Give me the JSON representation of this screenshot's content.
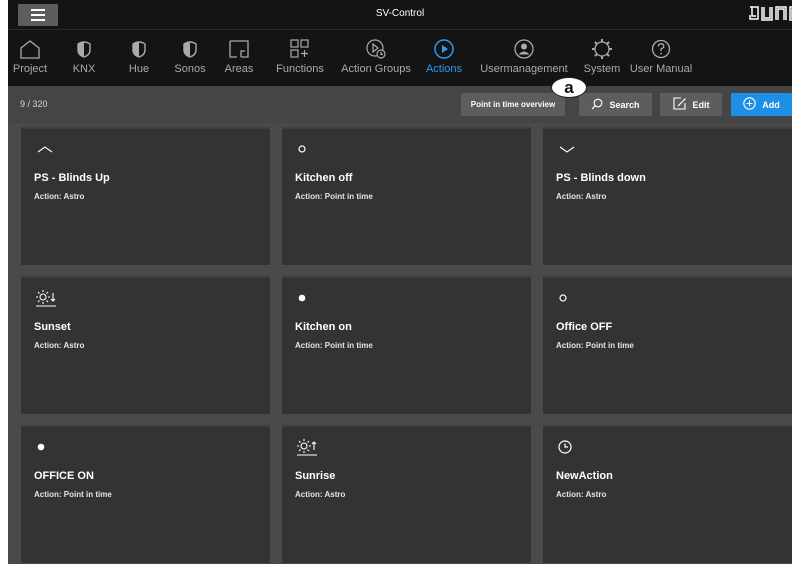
{
  "window": {
    "title": "SV-Control",
    "logo_text": "JUNG"
  },
  "nav": [
    {
      "label": "Project",
      "icon": "home-icon",
      "active": false
    },
    {
      "label": "KNX",
      "icon": "half-shield-icon",
      "active": false
    },
    {
      "label": "Hue",
      "icon": "half-shield-icon",
      "active": false
    },
    {
      "label": "Sonos",
      "icon": "half-shield-icon",
      "active": false
    },
    {
      "label": "Areas",
      "icon": "area-icon",
      "active": false
    },
    {
      "label": "Functions",
      "icon": "functions-grid-icon",
      "active": false
    },
    {
      "label": "Action Groups",
      "icon": "action-groups-icon",
      "active": false
    },
    {
      "label": "Actions",
      "icon": "play-circle-icon",
      "active": true
    },
    {
      "label": "Usermanagement",
      "icon": "user-circle-icon",
      "active": false
    },
    {
      "label": "System",
      "icon": "gear-icon",
      "active": false
    },
    {
      "label": "User Manual",
      "icon": "help-circle-icon",
      "active": false
    }
  ],
  "toolbar": {
    "count": "9 / 320",
    "point_in_time_label": "Point in time overview",
    "search_label": "Search",
    "edit_label": "Edit",
    "add_label": "Add",
    "callout": "a"
  },
  "cards": [
    {
      "name": "PS - Blinds Up",
      "action": "Action: Astro",
      "icon": "chevron-up-icon"
    },
    {
      "name": "Kitchen off",
      "action": "Action: Point in time",
      "icon": "circle-outline-icon"
    },
    {
      "name": "PS - Blinds down",
      "action": "Action: Astro",
      "icon": "chevron-down-icon"
    },
    {
      "name": "Sunset",
      "action": "Action: Astro",
      "icon": "sunset-icon"
    },
    {
      "name": "Kitchen on",
      "action": "Action: Point in time",
      "icon": "circle-filled-icon"
    },
    {
      "name": "Office OFF",
      "action": "Action: Point in time",
      "icon": "circle-outline-icon"
    },
    {
      "name": "OFFICE ON",
      "action": "Action: Point in time",
      "icon": "circle-filled-icon"
    },
    {
      "name": "Sunrise",
      "action": "Action: Astro",
      "icon": "sunrise-icon"
    },
    {
      "name": "NewAction",
      "action": "Action: Astro",
      "icon": "clock-icon"
    }
  ],
  "colors": {
    "accent": "#2b9af3",
    "add_button": "#1e8fe6",
    "card": "#333333",
    "toolbar": "#454545",
    "topbar": "#141414"
  }
}
